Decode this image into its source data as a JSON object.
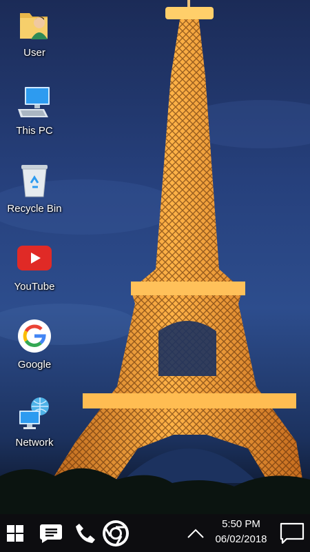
{
  "desktop": {
    "icons": [
      {
        "label": "User",
        "icon": "user-folder-icon"
      },
      {
        "label": "This PC",
        "icon": "computer-icon"
      },
      {
        "label": "Recycle Bin",
        "icon": "recycle-bin-icon"
      },
      {
        "label": "YouTube",
        "icon": "youtube-icon"
      },
      {
        "label": "Google",
        "icon": "google-icon"
      },
      {
        "label": "Network",
        "icon": "network-icon"
      }
    ]
  },
  "taskbar": {
    "start_icon": "windows-start-icon",
    "apps": [
      "messages-icon",
      "phone-icon",
      "chrome-icon"
    ],
    "tray_icon": "chevron-up-icon",
    "time": "5:50 PM",
    "date": "06/02/2018",
    "notifications_icon": "action-center-icon"
  },
  "colors": {
    "taskbar": "#0d0d10",
    "sky": "#243a73",
    "tower": "#f2a33a",
    "youtube_red": "#e02a26"
  }
}
